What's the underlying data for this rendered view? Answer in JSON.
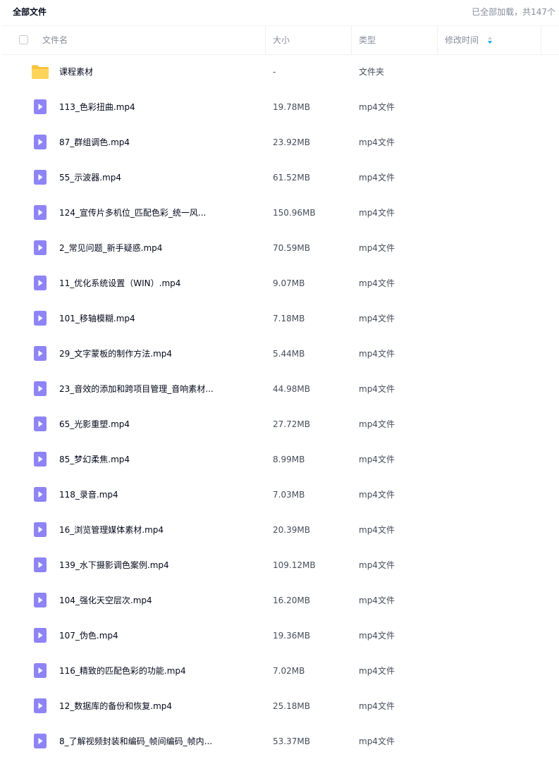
{
  "breadcrumb": "全部文件",
  "load_status": "已全部加载，共147个",
  "columns": {
    "name": "文件名",
    "size": "大小",
    "type": "类型",
    "modified": "修改时间"
  },
  "colors": {
    "folder": "#f9c33f",
    "video": "#8e84f5"
  },
  "files": [
    {
      "name": "课程素材",
      "size": "-",
      "type": "文件夹",
      "icon": "folder-icon"
    },
    {
      "name": "113_色彩扭曲.mp4",
      "size": "19.78MB",
      "type": "mp4文件",
      "icon": "video-file-icon"
    },
    {
      "name": "87_群组调色.mp4",
      "size": "23.92MB",
      "type": "mp4文件",
      "icon": "video-file-icon"
    },
    {
      "name": "55_示波器.mp4",
      "size": "61.52MB",
      "type": "mp4文件",
      "icon": "video-file-icon"
    },
    {
      "name": "124_宣传片多机位_匹配色彩_统一风...",
      "size": "150.96MB",
      "type": "mp4文件",
      "icon": "video-file-icon"
    },
    {
      "name": "2_常见问题_新手疑惑.mp4",
      "size": "70.59MB",
      "type": "mp4文件",
      "icon": "video-file-icon"
    },
    {
      "name": "11_优化系统设置（WIN）.mp4",
      "size": "9.07MB",
      "type": "mp4文件",
      "icon": "video-file-icon"
    },
    {
      "name": "101_移轴模糊.mp4",
      "size": "7.18MB",
      "type": "mp4文件",
      "icon": "video-file-icon"
    },
    {
      "name": "29_文字蒙板的制作方法.mp4",
      "size": "5.44MB",
      "type": "mp4文件",
      "icon": "video-file-icon"
    },
    {
      "name": "23_音效的添加和跨项目管理_音响素材...",
      "size": "44.98MB",
      "type": "mp4文件",
      "icon": "video-file-icon"
    },
    {
      "name": "65_光影重塑.mp4",
      "size": "27.72MB",
      "type": "mp4文件",
      "icon": "video-file-icon"
    },
    {
      "name": "85_梦幻柔焦.mp4",
      "size": "8.99MB",
      "type": "mp4文件",
      "icon": "video-file-icon"
    },
    {
      "name": "118_录音.mp4",
      "size": "7.03MB",
      "type": "mp4文件",
      "icon": "video-file-icon"
    },
    {
      "name": "16_浏览管理媒体素材.mp4",
      "size": "20.39MB",
      "type": "mp4文件",
      "icon": "video-file-icon"
    },
    {
      "name": "139_水下摄影调色案例.mp4",
      "size": "109.12MB",
      "type": "mp4文件",
      "icon": "video-file-icon"
    },
    {
      "name": "104_强化天空层次.mp4",
      "size": "16.20MB",
      "type": "mp4文件",
      "icon": "video-file-icon"
    },
    {
      "name": "107_伪色.mp4",
      "size": "19.36MB",
      "type": "mp4文件",
      "icon": "video-file-icon"
    },
    {
      "name": "116_精致的匹配色彩的功能.mp4",
      "size": "7.02MB",
      "type": "mp4文件",
      "icon": "video-file-icon"
    },
    {
      "name": "12_数据库的备份和恢复.mp4",
      "size": "25.18MB",
      "type": "mp4文件",
      "icon": "video-file-icon"
    },
    {
      "name": "8_了解视频封装和编码_帧间编码_帧内...",
      "size": "53.37MB",
      "type": "mp4文件",
      "icon": "video-file-icon"
    }
  ]
}
